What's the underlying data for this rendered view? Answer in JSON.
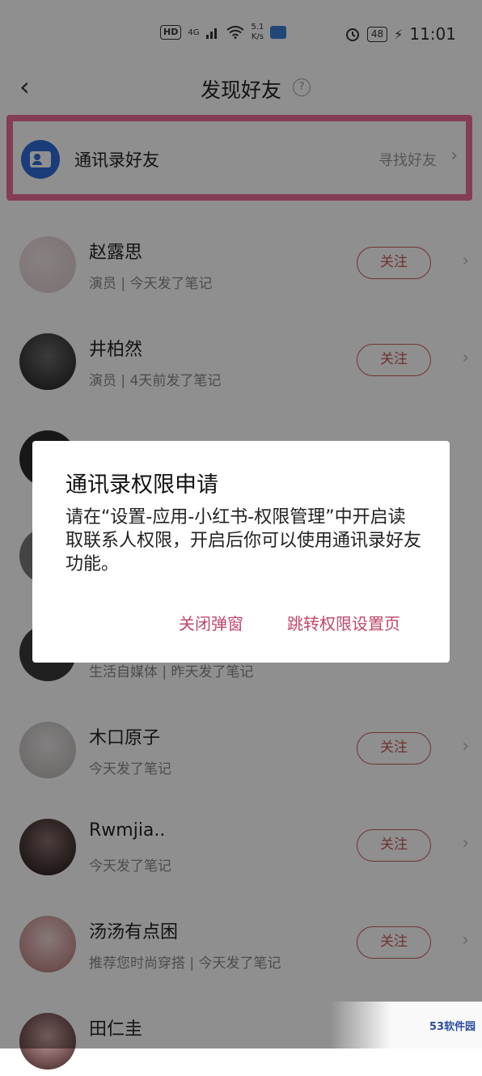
{
  "status_bar": {
    "hd": "HD",
    "network": "4G",
    "speed_top": "5.1",
    "speed_bottom": "K/s",
    "battery": "48",
    "time": "11:01"
  },
  "nav": {
    "title": "发现好友",
    "back": "‹",
    "help": "?"
  },
  "contacts": {
    "label": "通讯录好友",
    "action": "寻找好友",
    "chevron": "›"
  },
  "users": [
    {
      "name": "赵露思",
      "sub": "演员 | 今天发了笔记",
      "follow": "关注"
    },
    {
      "name": "井柏然",
      "sub": "演员 | 4天前发了笔记",
      "follow": "关注"
    },
    {
      "name": "",
      "sub": "",
      "follow": ""
    },
    {
      "name": "",
      "sub": "",
      "follow": ""
    },
    {
      "name": "",
      "sub": "生活自媒体 | 昨天发了笔记",
      "follow": ""
    },
    {
      "name": "木口原子",
      "sub": "今天发了笔记",
      "follow": "关注"
    },
    {
      "name": "Rwmjia..",
      "sub": "今天发了笔记",
      "follow": "关注"
    },
    {
      "name": "汤汤有点困",
      "sub": "推荐您时尚穿搭 | 今天发了笔记",
      "follow": "关注"
    },
    {
      "name": "田仁圭",
      "sub": "",
      "follow": ""
    }
  ],
  "dialog": {
    "title": "通讯录权限申请",
    "message": "请在“设置-应用-小红书-权限管理”中开启读取联系人权限，开启后你可以使用通讯录好友功能。",
    "close": "关闭弹窗",
    "go_settings": "跳转权限设置页"
  },
  "watermark": {
    "text": "53软件园"
  },
  "colors": {
    "accent": "#c0476a",
    "highlight": "#ec6e97",
    "contacts_icon": "#2f6bd8"
  }
}
